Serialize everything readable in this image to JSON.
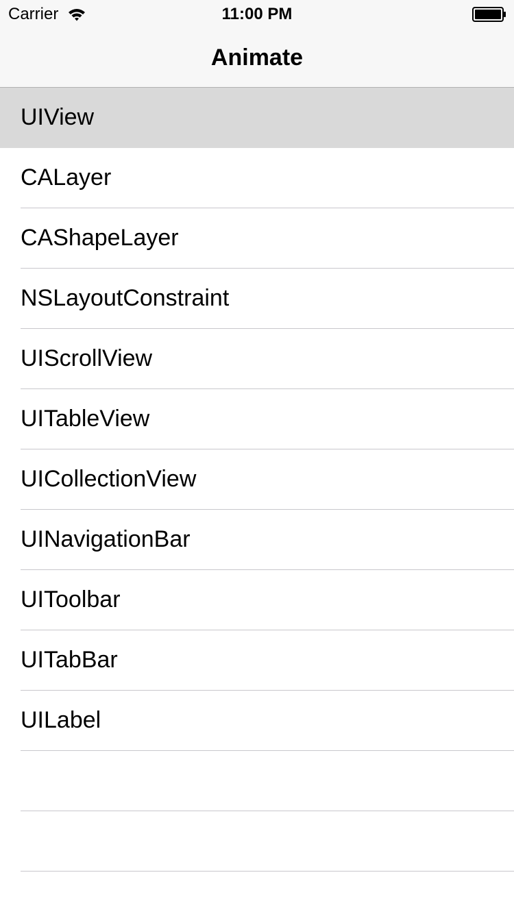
{
  "status_bar": {
    "carrier": "Carrier",
    "time": "11:00 PM",
    "wifi_icon": "wifi-icon",
    "battery_icon": "battery-icon"
  },
  "nav": {
    "title": "Animate"
  },
  "table": {
    "selected_index": 0,
    "selected_color": "#d9d9d9",
    "separator_color": "#c8c7cc",
    "rows": [
      {
        "label": "UIView"
      },
      {
        "label": "CALayer"
      },
      {
        "label": "CAShapeLayer"
      },
      {
        "label": "NSLayoutConstraint"
      },
      {
        "label": "UIScrollView"
      },
      {
        "label": "UITableView"
      },
      {
        "label": "UICollectionView"
      },
      {
        "label": "UINavigationBar"
      },
      {
        "label": "UIToolbar"
      },
      {
        "label": "UITabBar"
      },
      {
        "label": "UILabel"
      },
      {
        "label": ""
      },
      {
        "label": ""
      },
      {
        "label": ""
      }
    ]
  }
}
